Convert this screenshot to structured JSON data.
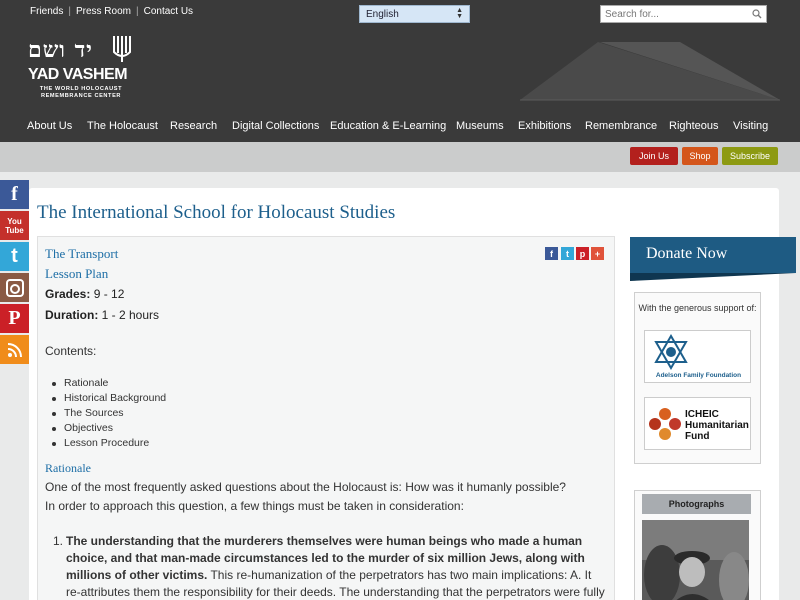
{
  "header": {
    "top_links": [
      "Friends",
      "Press Room",
      "Contact Us"
    ],
    "language": "English",
    "search_placeholder": "Search for...",
    "logo_hebrew": "יד ושם",
    "logo_name": "YAD VASHEM",
    "logo_sub1": "THE WORLD HOLOCAUST",
    "logo_sub2": "REMEMBRANCE CENTER"
  },
  "nav": [
    "About Us",
    "The Holocaust",
    "Research",
    "Digital Collections",
    "Education & E-Learning",
    "Museums",
    "Exhibitions",
    "Remembrance",
    "Righteous",
    "Visiting"
  ],
  "actions": {
    "join": "Join Us",
    "shop": "Shop",
    "subscribe": "Subscribe"
  },
  "social": {
    "facebook": "f",
    "youtube_1": "You",
    "youtube_2": "Tube",
    "twitter": "t",
    "pinterest": "P"
  },
  "share": {
    "facebook": "f",
    "twitter": "t",
    "pinterest": "p",
    "more": "+"
  },
  "page": {
    "title": "The International School for Holocaust Studies",
    "lesson_title": "The Transport",
    "lesson_type": "Lesson Plan",
    "grades_label": "Grades:",
    "grades_value": " 9 - 12",
    "duration_label": "Duration:",
    "duration_value": " 1 - 2 hours",
    "contents_heading": "Contents:",
    "contents": [
      "Rationale",
      "Historical Background",
      "The Sources",
      "Objectives",
      "Lesson Procedure"
    ],
    "section_heading": "Rationale",
    "para1": "One of the most frequently asked questions about the Holocaust is: How was it humanly possible?",
    "para2": "In order to approach this question, a few things must be taken in consideration:",
    "item1_num": "1.",
    "item1_bold": "The understanding that the murderers themselves were human beings who made a human choice, and that man-made circumstances led to the murder of six million Jews, along with millions of other victims.",
    "item1_rest": " This re-humanization of the perpetrators has two main implications: A. It re-attributes them the responsibility for their deeds. The understanding that the perpetrators were fully"
  },
  "sidebar": {
    "donate": "Donate Now",
    "support_text": "With the generous support of:",
    "sponsor1": "Adelson Family Foundation",
    "sponsor2_line1": "ICHEIC",
    "sponsor2_line2": "Humanitarian",
    "sponsor2_line3": "Fund",
    "photos_heading": "Photographs"
  },
  "colors": {
    "header_bg": "#3a3a3a",
    "title_blue": "#1d5f8c",
    "link_blue": "#1d6ea6",
    "join": "#b3201d",
    "shop": "#d4561b",
    "subscribe": "#8d9a12",
    "donate": "#1e5b83"
  }
}
